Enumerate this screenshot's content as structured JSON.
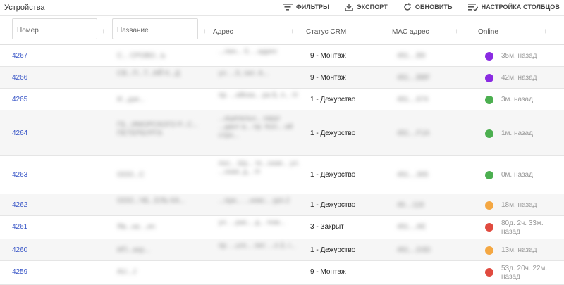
{
  "header": {
    "title": "Устройства",
    "actions": [
      {
        "label": "ФИЛЬТРЫ",
        "icon": "filter-icon"
      },
      {
        "label": "ЭКСПОРТ",
        "icon": "download-icon"
      },
      {
        "label": "ОБНОВИТЬ",
        "icon": "refresh-icon"
      },
      {
        "label": "НАСТРОЙКА СТОЛБЦОВ",
        "icon": "columns-settings-icon"
      }
    ]
  },
  "columns": {
    "number_placeholder": "Номер",
    "name_placeholder": "Название",
    "address": "Адрес",
    "crm": "Статус CRM",
    "mac": "MAC адрес",
    "online": "Online"
  },
  "status_colors": {
    "purple": "#8a2be2",
    "green": "#4caf50",
    "orange": "#f4a742",
    "red": "#e04a3f"
  },
  "rows": [
    {
      "number": "4267",
      "name": "С... СРОВО...Ь",
      "address": "...лин... 0, ...адрес",
      "crm": "9 - Монтаж",
      "mac": "491....B9",
      "status": "purple",
      "online": "35м. назад"
    },
    {
      "number": "4266",
      "name": "СВ...П...Т...ИЙ К...Д",
      "address": "ул. ...5, лит. А...",
      "crm": "9 - Монтаж",
      "mac": "491....BBF",
      "status": "purple",
      "online": "42м. назад"
    },
    {
      "number": "4265",
      "name": "И...дзе...",
      "address": "пр. ...ийска... ра Б, п... Н",
      "crm": "1 - Дежурство",
      "mac": "491....674",
      "status": "green",
      "online": "3м. назад"
    },
    {
      "number": "4264",
      "name": "ГБ...ИМОРСКОГО Р...С... ПЕТЕРБУРГА",
      "address": "...иципальн... округ ...дант а... пр. Кол... ий стро...",
      "crm": "1 - Дежурство",
      "mac": "491....F1A",
      "status": "green",
      "online": "1м. назад"
    },
    {
      "number": "4263",
      "name": "ООО...С",
      "address": "пос... Шу... те...ская... ул. ...ская, д... Н",
      "crm": "1 - Дежурство",
      "mac": "491....365",
      "status": "green",
      "online": "0м. назад"
    },
    {
      "number": "4262",
      "name": "ООО...ЧБ...ЕЛЬ КА...",
      "address": "...при... ...невс... урп.2",
      "crm": "1 - Дежурство",
      "mac": "49....118",
      "status": "orange",
      "online": "18м. назад"
    },
    {
      "number": "4261",
      "name": "Яв...на ...ич",
      "address": "ул. ...рас... д... пом...",
      "crm": "3 - Закрыт",
      "mac": "491....AE",
      "status": "red",
      "online": "80д. 2ч. 33м. назад"
    },
    {
      "number": "4260",
      "name": "ИП...кер...",
      "address": "пр. ...ьте... лит. ...п.3, г...",
      "crm": "1 - Дежурство",
      "mac": "491....D3D",
      "status": "orange",
      "online": "13м. назад"
    },
    {
      "number": "4259",
      "name": "AU...J",
      "address": "",
      "crm": "9 - Монтаж",
      "mac": "",
      "status": "red",
      "online": "53д. 20ч. 22м. назад"
    }
  ]
}
